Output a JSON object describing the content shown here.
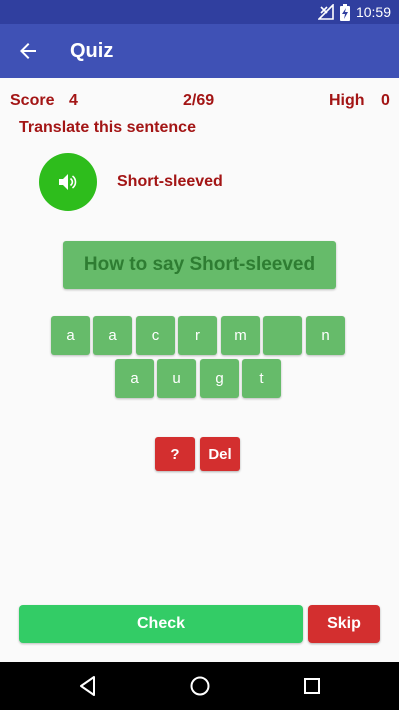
{
  "status_bar": {
    "time": "10:59"
  },
  "app_bar": {
    "title": "Quiz",
    "back_icon": "arrow-back-icon"
  },
  "score": {
    "label": "Score",
    "value": "4",
    "progress": "2/69",
    "high_label": "High",
    "high_value": "0"
  },
  "prompt": "Translate this sentence",
  "word": "Short-sleeved",
  "answer_placeholder": "How to say Short-sleeved",
  "keyboard": {
    "row1": [
      "a",
      "a",
      "c",
      "r",
      "m",
      "",
      "n"
    ],
    "row2": [
      "a",
      "u",
      "g",
      "t"
    ]
  },
  "actions": {
    "hint_label": "?",
    "delete_label": "Del",
    "check_label": "Check",
    "skip_label": "Skip"
  },
  "colors": {
    "primary": "#3f51b5",
    "primary_dark": "#303f9f",
    "accent_green": "#33cc66",
    "key_green": "#66bb6a",
    "red": "#d32f2f",
    "text_red": "#a31515"
  }
}
